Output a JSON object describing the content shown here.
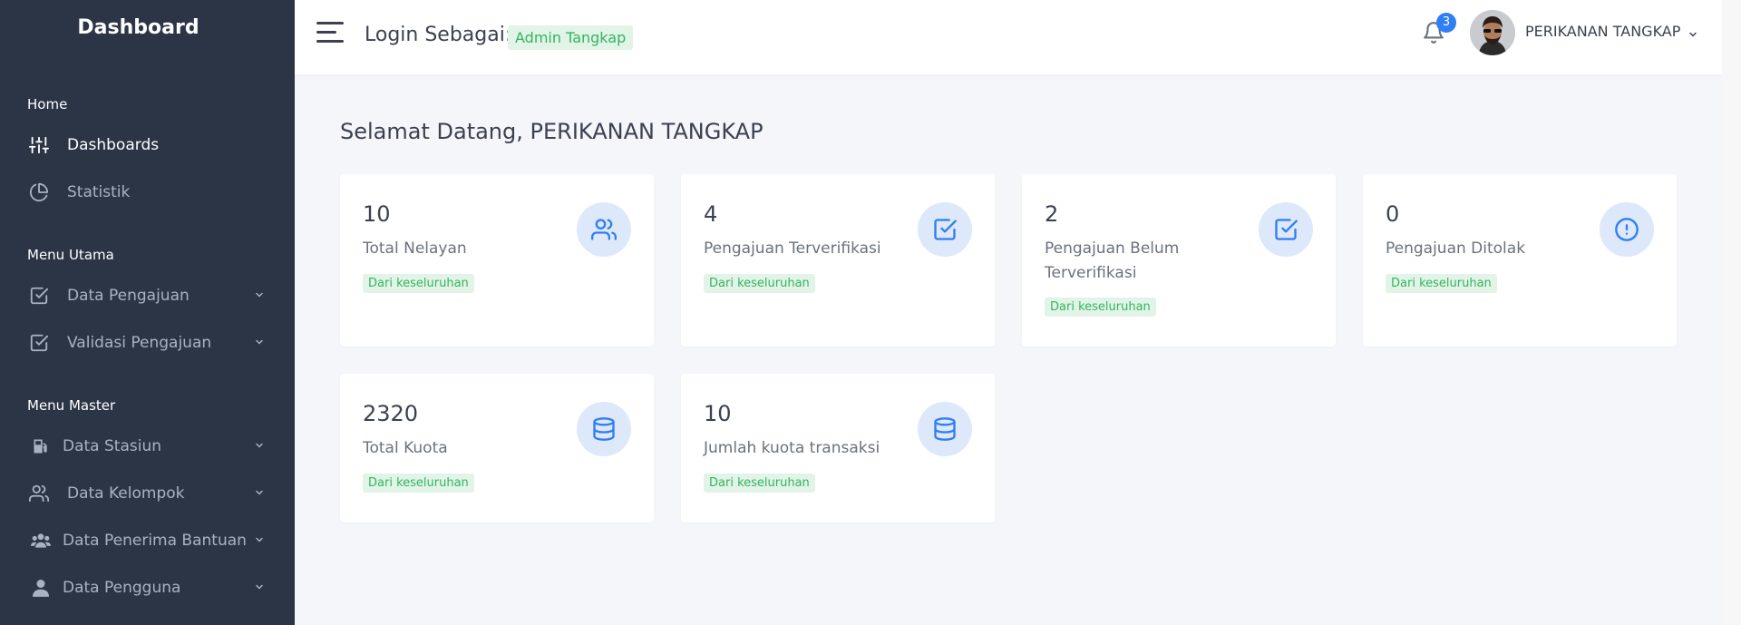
{
  "sidebar": {
    "brand": "Dashboard",
    "sections": {
      "home": "Home",
      "menu_utama": "Menu Utama",
      "menu_master": "Menu Master"
    },
    "items": [
      {
        "label": "Dashboards",
        "icon": "sliders-icon",
        "active": true
      },
      {
        "label": "Statistik",
        "icon": "pie-chart-icon"
      },
      {
        "label": "Data Pengajuan",
        "icon": "check-square-icon",
        "has_submenu": true
      },
      {
        "label": "Validasi Pengajuan",
        "icon": "check-square-icon",
        "has_submenu": true
      },
      {
        "label": "Data Stasiun",
        "icon": "gas-pump-icon",
        "has_submenu": true
      },
      {
        "label": "Data Kelompok",
        "icon": "users-icon",
        "has_submenu": true
      },
      {
        "label": "Data Penerima Bantuan",
        "icon": "user-group-icon",
        "has_submenu": true
      },
      {
        "label": "Data Pengguna",
        "icon": "user-icon",
        "has_submenu": true
      }
    ]
  },
  "header": {
    "login_label": "Login Sebagai:",
    "role": "Admin Tangkap",
    "notification_count": "3",
    "user_name": "PERIKANAN TANGKAP"
  },
  "main": {
    "welcome": "Selamat Datang, PERIKANAN TANGKAP",
    "cards": [
      {
        "value": "10",
        "label": "Total Nelayan",
        "badge": "Dari keseluruhan",
        "icon": "users-icon"
      },
      {
        "value": "4",
        "label": "Pengajuan Terverifikasi",
        "badge": "Dari keseluruhan",
        "icon": "check-square-icon"
      },
      {
        "value": "2",
        "label": "Pengajuan Belum Terverifikasi",
        "badge": "Dari keseluruhan",
        "icon": "check-square-icon"
      },
      {
        "value": "0",
        "label": "Pengajuan Ditolak",
        "badge": "Dari keseluruhan",
        "icon": "alert-circle-icon"
      },
      {
        "value": "2320",
        "label": "Total Kuota",
        "badge": "Dari keseluruhan",
        "icon": "database-icon"
      },
      {
        "value": "10",
        "label": "Jumlah kuota transaksi",
        "badge": "Dari keseluruhan",
        "icon": "database-icon"
      }
    ]
  },
  "colors": {
    "sidebar_bg": "#2c3546",
    "accent_blue": "#2f7ef3",
    "badge_green": "#34b45e",
    "badge_green_bg": "#e1f4e7",
    "icon_circle_bg": "#dde8fb"
  }
}
